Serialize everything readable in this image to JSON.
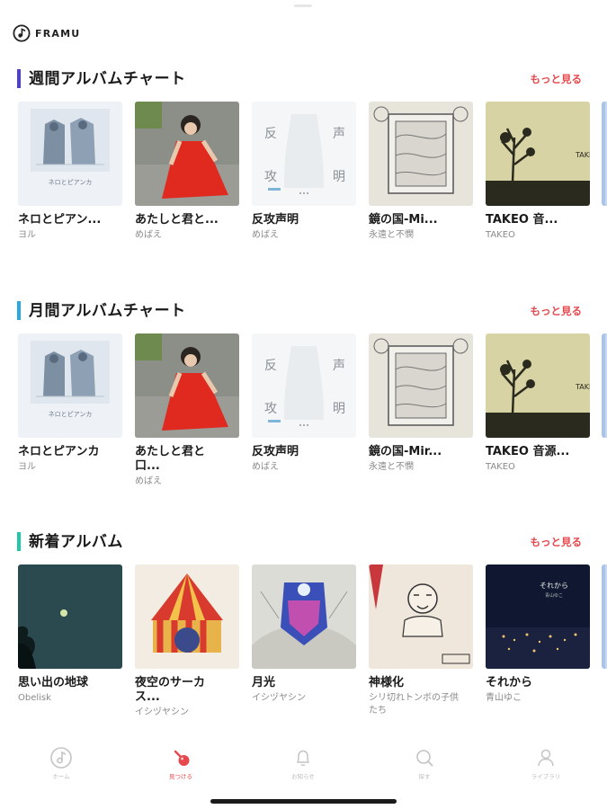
{
  "app": {
    "brand": "FRAMU"
  },
  "sections": [
    {
      "title": "週間アルバムチャート",
      "more": "もっと見る",
      "accent": "#4b3fd6",
      "albums": [
        {
          "title": "ネロとピアン...",
          "artist": "ヨル",
          "cover": "nero"
        },
        {
          "title": "あたしと君と...",
          "artist": "めばえ",
          "cover": "red-dress"
        },
        {
          "title": "反攻声明",
          "artist": "めばえ",
          "cover": "hanko"
        },
        {
          "title": "鏡の国-Mi...",
          "artist": "永遠と不憫",
          "cover": "mirror"
        },
        {
          "title": "TAKEO 音...",
          "artist": "TAKEO",
          "cover": "takeo"
        },
        {
          "title": "",
          "artist": "",
          "cover": "blue-edge"
        }
      ]
    },
    {
      "title": "月間アルバムチャート",
      "more": "もっと見る",
      "accent": "#2aa8e0",
      "albums": [
        {
          "title": "ネロとピアンカ",
          "artist": "ヨル",
          "cover": "nero"
        },
        {
          "title": "あたしと君と口...",
          "artist": "めばえ",
          "cover": "red-dress"
        },
        {
          "title": "反攻声明",
          "artist": "めばえ",
          "cover": "hanko"
        },
        {
          "title": "鏡の国-Mir...",
          "artist": "永遠と不憫",
          "cover": "mirror"
        },
        {
          "title": "TAKEO 音源...",
          "artist": "TAKEO",
          "cover": "takeo"
        },
        {
          "title": "",
          "artist": "",
          "cover": "blue-edge"
        }
      ]
    },
    {
      "title": "新着アルバム",
      "more": "もっと見る",
      "accent": "#1fc8a6",
      "albums": [
        {
          "title": "思い出の地球",
          "artist": "Obelisk",
          "cover": "earth"
        },
        {
          "title": "夜空のサーカス...",
          "artist": "イシヅヤシン",
          "cover": "circus"
        },
        {
          "title": "月光",
          "artist": "イシヅヤシン",
          "cover": "moonlight"
        },
        {
          "title": "神様化",
          "artist": "シリ切れトンボの子供たち",
          "cover": "kamisama"
        },
        {
          "title": "それから",
          "artist": "青山ゆこ",
          "cover": "sorekara"
        },
        {
          "title": "",
          "artist": "",
          "cover": "blue-edge"
        }
      ]
    }
  ],
  "tabs": [
    {
      "label": "ホーム",
      "icon": "music-note-icon",
      "active": false
    },
    {
      "label": "見つける",
      "icon": "pin-icon",
      "active": true
    },
    {
      "label": "お知らせ",
      "icon": "bell-icon",
      "active": false
    },
    {
      "label": "探す",
      "icon": "search-icon",
      "active": false
    },
    {
      "label": "ライブラリ",
      "icon": "person-icon",
      "active": false
    }
  ],
  "colors": {
    "accent_red": "#e5484d",
    "inactive": "#bdbdbd"
  }
}
